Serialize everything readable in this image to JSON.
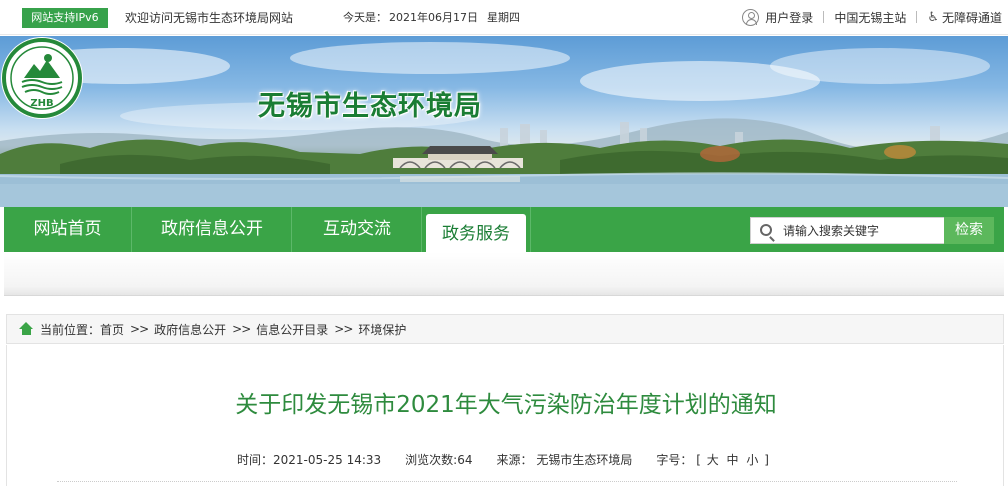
{
  "topbar": {
    "ipv6_badge": "网站支持IPv6",
    "welcome": "欢迎访问无锡市生态环境局网站",
    "date_label": "今天是：",
    "date": "2021年06月17日",
    "weekday": "星期四",
    "login": "用户登录",
    "main_site": "中国无锡主站",
    "accessibility": "无障碍通道"
  },
  "banner": {
    "site_name": "无锡市生态环境局",
    "logo_text": "ZHB"
  },
  "nav": {
    "items": [
      {
        "label": "网站首页"
      },
      {
        "label": "政府信息公开"
      },
      {
        "label": "互动交流"
      },
      {
        "label": "政务服务"
      }
    ],
    "active_index": 3,
    "search_placeholder": "请输入搜索关键字",
    "search_button": "检索"
  },
  "breadcrumb": {
    "label": "当前位置：",
    "items": [
      "首页",
      "政府信息公开",
      "信息公开目录",
      "环境保护"
    ],
    "separator": ">>"
  },
  "article": {
    "title": "关于印发无锡市2021年大气污染防治年度计划的通知",
    "time_label": "时间：",
    "time": "2021-05-25 14:33",
    "views_label": "浏览次数:",
    "views": "64",
    "source_label": "来源：",
    "source": "无锡市生态环境局",
    "fontsize_label": "字号：",
    "fontsize_open": "[",
    "fontsize_large": "大",
    "fontsize_medium": "中",
    "fontsize_small": "小",
    "fontsize_close": "]"
  },
  "colors": {
    "brand_green": "#3aa447",
    "title_green": "#2e8b3e"
  }
}
